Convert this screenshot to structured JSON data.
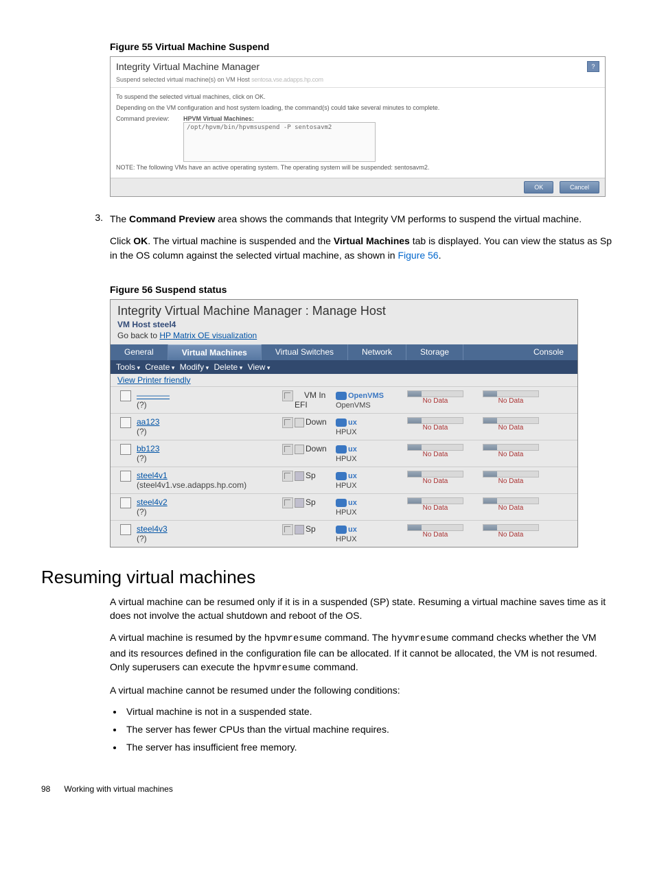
{
  "figure55": {
    "caption": "Figure 55 Virtual Machine Suspend",
    "window_title": "Integrity Virtual Machine Manager",
    "help_label": "?",
    "subtitle_prefix": "Suspend selected virtual machine(s) on VM Host ",
    "subtitle_blurred": "sentosa.vse.adapps.hp.com",
    "line1": "To suspend the selected virtual machines, click on OK.",
    "line2": "Depending on the VM configuration and host system loading, the command(s) could take several minutes to complete.",
    "preview_label": "Command preview:",
    "preview_heading": "HPVM Virtual Machines:",
    "preview_text": "/opt/hpvm/bin/hpvmsuspend -P sentosavm2",
    "note": "NOTE: The following VMs have an active operating system. The operating system will be suspended: sentosavm2.",
    "ok": "OK",
    "cancel": "Cancel"
  },
  "step3": {
    "num": "3.",
    "p1a": "The ",
    "p1b": "Command Preview",
    "p1c": " area shows the commands that Integrity VM performs to suspend the virtual machine.",
    "p2a": "Click ",
    "p2b": "OK",
    "p2c": ". The virtual machine is suspended and the ",
    "p2d": "Virtual Machines",
    "p2e": " tab is displayed. You can view the status as Sp in the OS column against the selected virtual machine, as shown in ",
    "p2f": "Figure 56",
    "p2g": "."
  },
  "figure56": {
    "caption": "Figure 56 Suspend status",
    "title": "Integrity Virtual Machine Manager : Manage Host",
    "hostline": "VM Host steel4",
    "back_prefix": "Go back to ",
    "back_link": "HP Matrix OE visualization",
    "tabs": [
      "General",
      "Virtual Machines",
      "Virtual Switches",
      "Network",
      "Storage",
      "Console"
    ],
    "active_tab": 1,
    "menus": [
      "Tools",
      "Create",
      "Modify",
      "Delete",
      "View"
    ],
    "printer_friendly": "View Printer friendly",
    "nodata": "No Data",
    "rows": [
      {
        "name": "————",
        "sub": "(?)",
        "state": "VM In",
        "state2": "EFI",
        "os": "OpenVMS",
        "oslabel": "OpenVMS",
        "sp": false,
        "vmin": true
      },
      {
        "name": "aa123",
        "sub": "(?)",
        "state": "Down",
        "state2": "",
        "os": "HPUX",
        "oslabel": "ux",
        "sp": false,
        "vmin": false
      },
      {
        "name": "bb123",
        "sub": "(?)",
        "state": "Down",
        "state2": "",
        "os": "HPUX",
        "oslabel": "ux",
        "sp": false,
        "vmin": false
      },
      {
        "name": "steel4v1",
        "sub": "(steel4v1.vse.adapps.hp.com)",
        "state": "Sp",
        "state2": "",
        "os": "HPUX",
        "oslabel": "ux",
        "sp": true,
        "vmin": false
      },
      {
        "name": "steel4v2",
        "sub": "(?)",
        "state": "Sp",
        "state2": "",
        "os": "HPUX",
        "oslabel": "ux",
        "sp": true,
        "vmin": false
      },
      {
        "name": "steel4v3",
        "sub": "(?)",
        "state": "Sp",
        "state2": "",
        "os": "HPUX",
        "oslabel": "ux",
        "sp": true,
        "vmin": false
      }
    ]
  },
  "section": {
    "heading": "Resuming virtual machines",
    "p1": "A virtual machine can be resumed only if it is in a suspended (SP) state. Resuming a virtual machine saves time as it does not involve the actual shutdown and reboot of the OS.",
    "p2a": "A virtual machine is resumed by the ",
    "p2b": "hpvmresume",
    "p2c": " command. The ",
    "p2d": "hyvmresume",
    "p2e": " command checks whether the VM and its resources defined in the configuration file can be allocated. If it cannot be allocated, the VM is not resumed. Only superusers can execute the ",
    "p2f": "hpvmresume",
    "p2g": " command.",
    "p3": "A virtual machine cannot be resumed under the following conditions:",
    "bullets": [
      "Virtual machine is not in a suspended state.",
      "The server has fewer CPUs than the virtual machine requires.",
      "The server has insufficient free memory."
    ]
  },
  "footer": {
    "page": "98",
    "chapter": "Working with virtual machines"
  }
}
